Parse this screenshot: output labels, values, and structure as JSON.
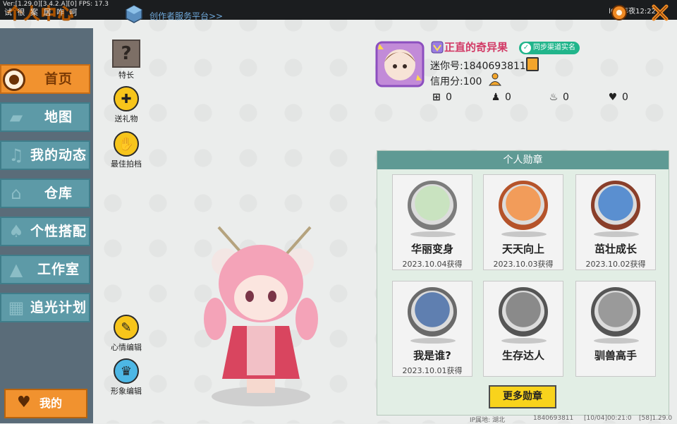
{
  "status_bar": {
    "version": "Ver:[1.29.0][3.4.2.A][0] FPS: 17.3",
    "garbled_text": "试 很 案 居 咋 呵",
    "page_title": "个人中心",
    "creator_link": "创作者服务平台>>",
    "system_right": "l6k  年夜12:22"
  },
  "sidebar": {
    "items": [
      {
        "label": "首页",
        "icon": "home-icon"
      },
      {
        "label": "地图",
        "icon": "map-icon"
      },
      {
        "label": "我的动态",
        "icon": "bell-icon"
      },
      {
        "label": "仓库",
        "icon": "house-icon"
      },
      {
        "label": "个性搭配",
        "icon": "shirt-icon"
      },
      {
        "label": "工作室",
        "icon": "studio-icon"
      },
      {
        "label": "追光计划",
        "icon": "calendar-icon"
      }
    ],
    "mine_label": "我的"
  },
  "actions": {
    "specialty": "特长",
    "send_gift": "送礼物",
    "best_partner": "最佳拍档",
    "mood_edit": "心情编辑",
    "image_edit": "形象编辑"
  },
  "profile": {
    "nickname": "正直的奇异果",
    "sync_label": "同步渠道实名",
    "mini_id": "迷你号:1840693811",
    "credit": "信用分:100",
    "stats": [
      {
        "icon": "plus-icon",
        "value": "0"
      },
      {
        "icon": "fans-icon",
        "value": "0"
      },
      {
        "icon": "flame-icon",
        "value": "0"
      },
      {
        "icon": "heart-icon",
        "value": "0"
      }
    ]
  },
  "medals": {
    "title": "个人勋章",
    "items": [
      {
        "name": "华丽变身",
        "date": "2023.10.04获得",
        "ring": "#7c7c7c",
        "fill": "#c9e3c0"
      },
      {
        "name": "天天向上",
        "date": "2023.10.03获得",
        "ring": "#b5532a",
        "fill": "#f29c5a"
      },
      {
        "name": "茁壮成长",
        "date": "2023.10.02获得",
        "ring": "#8a3f2a",
        "fill": "#5a8fd0"
      },
      {
        "name": "我是谁?",
        "date": "2023.10.01获得",
        "ring": "#6a6a6a",
        "fill": "#5f7fb0"
      },
      {
        "name": "生存达人",
        "date": "",
        "ring": "#555555",
        "fill": "#8a8a8a"
      },
      {
        "name": "驯兽高手",
        "date": "",
        "ring": "#555555",
        "fill": "#9a9a9a"
      }
    ],
    "more_label": "更多勋章"
  },
  "footer": {
    "ip": "IP属地: 湖北",
    "uid": "1840693811",
    "time": "[10/04]00:21:0",
    "build": "[58]1.29.0"
  }
}
